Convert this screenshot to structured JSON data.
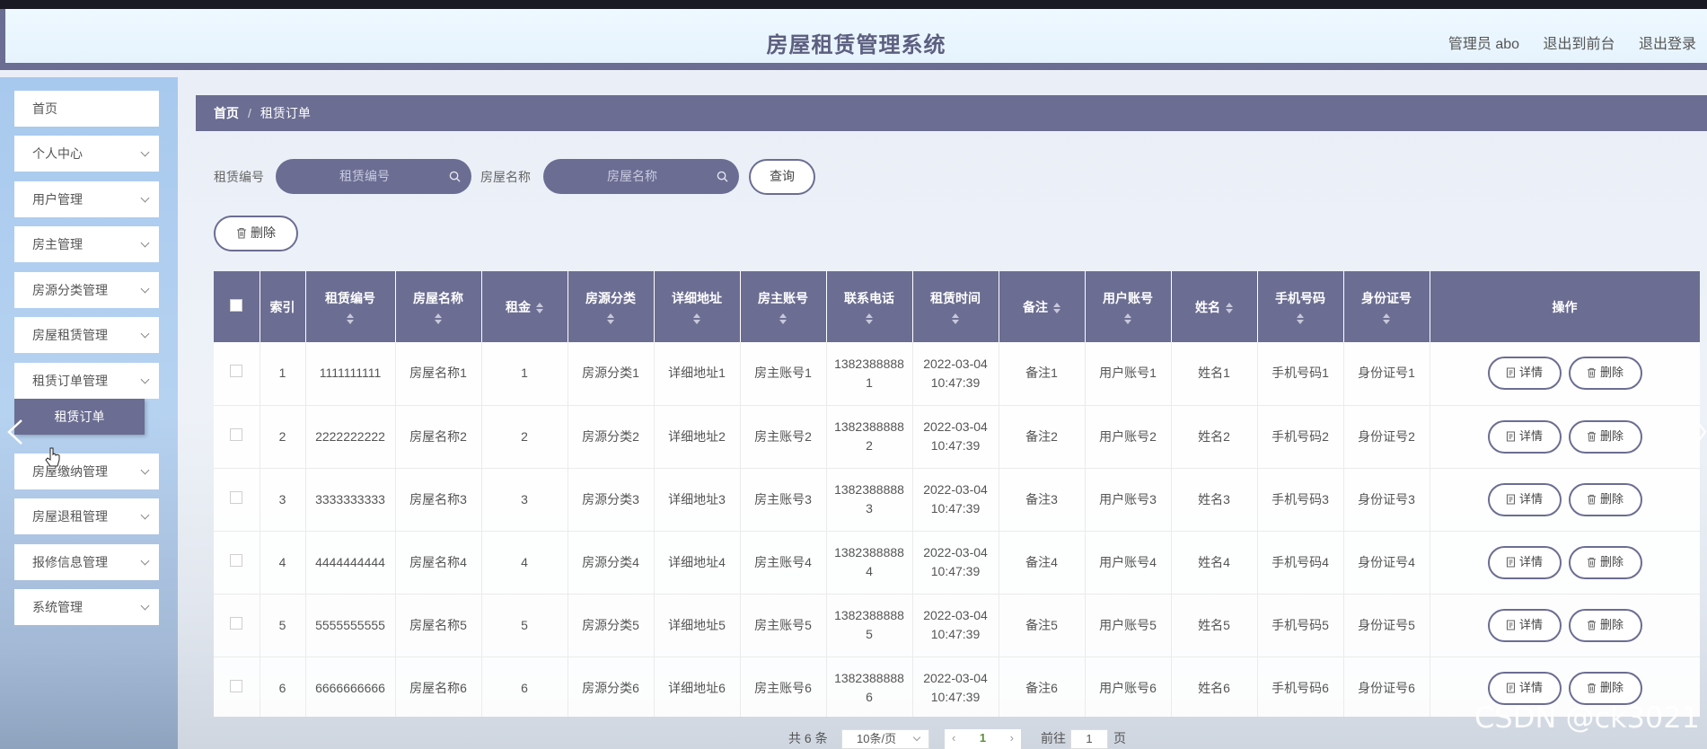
{
  "header": {
    "title": "房屋租赁管理系统",
    "user": "管理员 abo",
    "front": "退出到前台",
    "logout": "退出登录"
  },
  "sidebar": {
    "items": [
      {
        "label": "首页",
        "expandable": false
      },
      {
        "label": "个人中心",
        "expandable": true
      },
      {
        "label": "用户管理",
        "expandable": true
      },
      {
        "label": "房主管理",
        "expandable": true
      },
      {
        "label": "房源分类管理",
        "expandable": true
      },
      {
        "label": "房屋租赁管理",
        "expandable": true
      },
      {
        "label": "租赁订单管理",
        "expandable": true
      },
      {
        "label": "房屋缴纳管理",
        "expandable": true
      },
      {
        "label": "房屋退租管理",
        "expandable": true
      },
      {
        "label": "报修信息管理",
        "expandable": true
      },
      {
        "label": "系统管理",
        "expandable": true
      }
    ],
    "active_sub": "租赁订单"
  },
  "breadcrumb": {
    "home": "首页",
    "sep": "/",
    "current": "租赁订单"
  },
  "search": {
    "order_label": "租赁编号",
    "order_placeholder": "租赁编号",
    "name_label": "房屋名称",
    "name_placeholder": "房屋名称",
    "query": "查询"
  },
  "toolbar": {
    "delete": "删除"
  },
  "table": {
    "headers": [
      "索引",
      "租赁编号",
      "房屋名称",
      "租金",
      "房源分类",
      "详细地址",
      "房主账号",
      "联系电话",
      "租赁时间",
      "备注",
      "用户账号",
      "姓名",
      "手机号码",
      "身份证号",
      "操作"
    ],
    "detail_label": "详情",
    "delete_label": "删除",
    "rows": [
      [
        "1",
        "1111111111",
        "房屋名称1",
        "1",
        "房源分类1",
        "详细地址1",
        "房主账号1",
        "13823888881",
        "2022-03-04 10:47:39",
        "备注1",
        "用户账号1",
        "姓名1",
        "手机号码1",
        "身份证号1"
      ],
      [
        "2",
        "2222222222",
        "房屋名称2",
        "2",
        "房源分类2",
        "详细地址2",
        "房主账号2",
        "13823888882",
        "2022-03-04 10:47:39",
        "备注2",
        "用户账号2",
        "姓名2",
        "手机号码2",
        "身份证号2"
      ],
      [
        "3",
        "3333333333",
        "房屋名称3",
        "3",
        "房源分类3",
        "详细地址3",
        "房主账号3",
        "13823888883",
        "2022-03-04 10:47:39",
        "备注3",
        "用户账号3",
        "姓名3",
        "手机号码3",
        "身份证号3"
      ],
      [
        "4",
        "4444444444",
        "房屋名称4",
        "4",
        "房源分类4",
        "详细地址4",
        "房主账号4",
        "13823888884",
        "2022-03-04 10:47:39",
        "备注4",
        "用户账号4",
        "姓名4",
        "手机号码4",
        "身份证号4"
      ],
      [
        "5",
        "5555555555",
        "房屋名称5",
        "5",
        "房源分类5",
        "详细地址5",
        "房主账号5",
        "13823888885",
        "2022-03-04 10:47:39",
        "备注5",
        "用户账号5",
        "姓名5",
        "手机号码5",
        "身份证号5"
      ],
      [
        "6",
        "6666666666",
        "房屋名称6",
        "6",
        "房源分类6",
        "详细地址6",
        "房主账号6",
        "13823888886",
        "2022-03-04 10:47:39",
        "备注6",
        "用户账号6",
        "姓名6",
        "手机号码6",
        "身份证号6"
      ]
    ]
  },
  "pagination": {
    "total": "共 6 条",
    "page_size": "10条/页",
    "current_page": "1",
    "goto_label": "前往",
    "goto_value": "1",
    "page_unit": "页"
  },
  "watermark": "CSDN @ck3021"
}
